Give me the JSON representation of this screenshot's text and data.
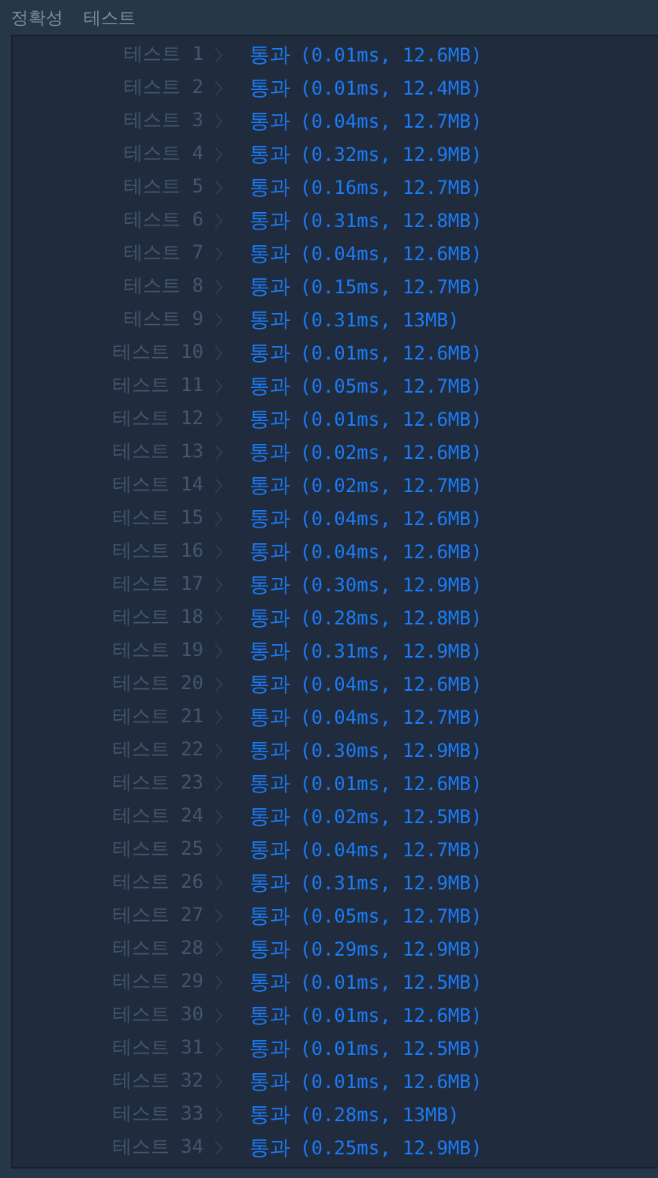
{
  "header": {
    "title": "정확성  테스트"
  },
  "rows": [
    {
      "label": "테스트 1",
      "status": "통과",
      "result": "(0.01ms, 12.6MB)"
    },
    {
      "label": "테스트 2",
      "status": "통과",
      "result": "(0.01ms, 12.4MB)"
    },
    {
      "label": "테스트 3",
      "status": "통과",
      "result": "(0.04ms, 12.7MB)"
    },
    {
      "label": "테스트 4",
      "status": "통과",
      "result": "(0.32ms, 12.9MB)"
    },
    {
      "label": "테스트 5",
      "status": "통과",
      "result": "(0.16ms, 12.7MB)"
    },
    {
      "label": "테스트 6",
      "status": "통과",
      "result": "(0.31ms, 12.8MB)"
    },
    {
      "label": "테스트 7",
      "status": "통과",
      "result": "(0.04ms, 12.6MB)"
    },
    {
      "label": "테스트 8",
      "status": "통과",
      "result": "(0.15ms, 12.7MB)"
    },
    {
      "label": "테스트 9",
      "status": "통과",
      "result": "(0.31ms, 13MB)"
    },
    {
      "label": "테스트 10",
      "status": "통과",
      "result": "(0.01ms, 12.6MB)"
    },
    {
      "label": "테스트 11",
      "status": "통과",
      "result": "(0.05ms, 12.7MB)"
    },
    {
      "label": "테스트 12",
      "status": "통과",
      "result": "(0.01ms, 12.6MB)"
    },
    {
      "label": "테스트 13",
      "status": "통과",
      "result": "(0.02ms, 12.6MB)"
    },
    {
      "label": "테스트 14",
      "status": "통과",
      "result": "(0.02ms, 12.7MB)"
    },
    {
      "label": "테스트 15",
      "status": "통과",
      "result": "(0.04ms, 12.6MB)"
    },
    {
      "label": "테스트 16",
      "status": "통과",
      "result": "(0.04ms, 12.6MB)"
    },
    {
      "label": "테스트 17",
      "status": "통과",
      "result": "(0.30ms, 12.9MB)"
    },
    {
      "label": "테스트 18",
      "status": "통과",
      "result": "(0.28ms, 12.8MB)"
    },
    {
      "label": "테스트 19",
      "status": "통과",
      "result": "(0.31ms, 12.9MB)"
    },
    {
      "label": "테스트 20",
      "status": "통과",
      "result": "(0.04ms, 12.6MB)"
    },
    {
      "label": "테스트 21",
      "status": "통과",
      "result": "(0.04ms, 12.7MB)"
    },
    {
      "label": "테스트 22",
      "status": "통과",
      "result": "(0.30ms, 12.9MB)"
    },
    {
      "label": "테스트 23",
      "status": "통과",
      "result": "(0.01ms, 12.6MB)"
    },
    {
      "label": "테스트 24",
      "status": "통과",
      "result": "(0.02ms, 12.5MB)"
    },
    {
      "label": "테스트 25",
      "status": "통과",
      "result": "(0.04ms, 12.7MB)"
    },
    {
      "label": "테스트 26",
      "status": "통과",
      "result": "(0.31ms, 12.9MB)"
    },
    {
      "label": "테스트 27",
      "status": "통과",
      "result": "(0.05ms, 12.7MB)"
    },
    {
      "label": "테스트 28",
      "status": "통과",
      "result": "(0.29ms, 12.9MB)"
    },
    {
      "label": "테스트 29",
      "status": "통과",
      "result": "(0.01ms, 12.5MB)"
    },
    {
      "label": "테스트 30",
      "status": "통과",
      "result": "(0.01ms, 12.6MB)"
    },
    {
      "label": "테스트 31",
      "status": "통과",
      "result": "(0.01ms, 12.5MB)"
    },
    {
      "label": "테스트 32",
      "status": "통과",
      "result": "(0.01ms, 12.6MB)"
    },
    {
      "label": "테스트 33",
      "status": "통과",
      "result": "(0.28ms, 13MB)"
    },
    {
      "label": "테스트 34",
      "status": "통과",
      "result": "(0.25ms, 12.9MB)"
    }
  ]
}
